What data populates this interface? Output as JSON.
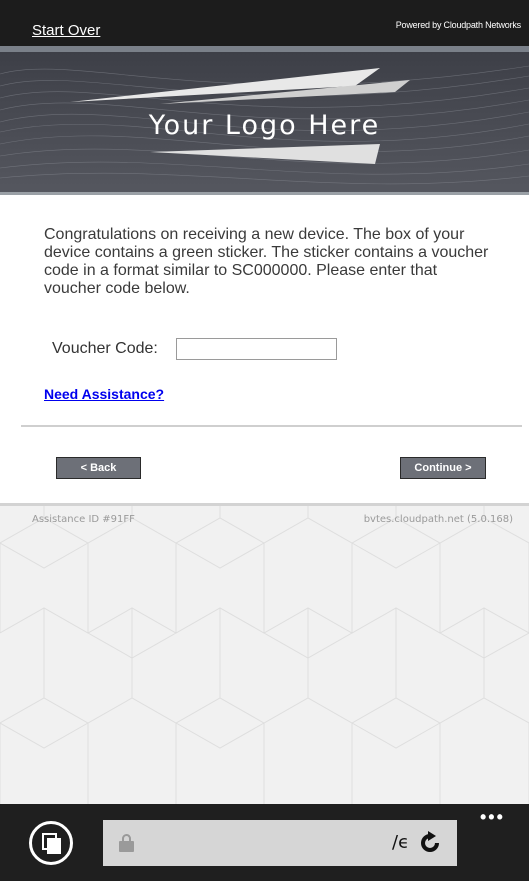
{
  "header": {
    "start_over": "Start Over",
    "powered_by": "Powered by Cloudpath Networks"
  },
  "banner": {
    "logo_text": "Your Logo Here"
  },
  "main": {
    "intro": "Congratulations on receiving a new device. The box of your device contains a green sticker. The sticker contains a voucher code in a format similar to SC000000. Please enter that voucher code below.",
    "voucher_label": "Voucher Code:",
    "voucher_value": "",
    "help_link": "Need Assistance?",
    "back_label": "< Back",
    "continue_label": "Continue >"
  },
  "footer": {
    "assistance_id": "Assistance ID #91FF",
    "version": "bvtes.cloudpath.net (5.0.168)"
  },
  "browser": {
    "address_text": "/ϵ",
    "icons": [
      "tabs-icon",
      "lock-icon",
      "refresh-icon",
      "more-icon"
    ]
  }
}
